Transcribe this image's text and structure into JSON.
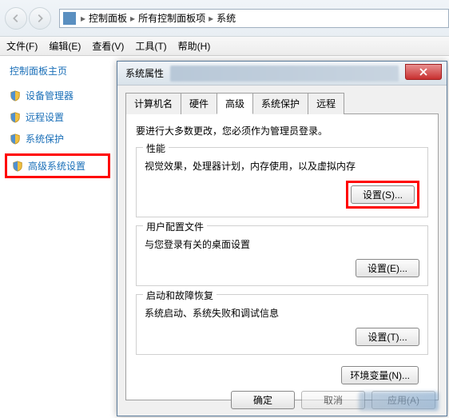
{
  "nav": {
    "breadcrumb": [
      "控制面板",
      "所有控制面板项",
      "系统"
    ]
  },
  "menu": {
    "file": "文件(F)",
    "edit": "编辑(E)",
    "view": "查看(V)",
    "tools": "工具(T)",
    "help": "帮助(H)"
  },
  "sidebar": {
    "header": "控制面板主页",
    "items": [
      {
        "label": "设备管理器"
      },
      {
        "label": "远程设置"
      },
      {
        "label": "系统保护"
      },
      {
        "label": "高级系统设置"
      }
    ]
  },
  "dialog": {
    "title": "系统属性",
    "tabs": {
      "computer_name": "计算机名",
      "hardware": "硬件",
      "advanced": "高级",
      "system_protection": "系统保护",
      "remote": "远程"
    },
    "intro": "要进行大多数更改，您必须作为管理员登录。",
    "groups": {
      "performance": {
        "title": "性能",
        "desc": "视觉效果，处理器计划，内存使用，以及虚拟内存",
        "button": "设置(S)..."
      },
      "user_profiles": {
        "title": "用户配置文件",
        "desc": "与您登录有关的桌面设置",
        "button": "设置(E)..."
      },
      "startup": {
        "title": "启动和故障恢复",
        "desc": "系统启动、系统失败和调试信息",
        "button": "设置(T)..."
      }
    },
    "env_button": "环境变量(N)...",
    "footer": {
      "ok": "确定",
      "cancel": "取消",
      "apply": "应用(A)"
    }
  }
}
